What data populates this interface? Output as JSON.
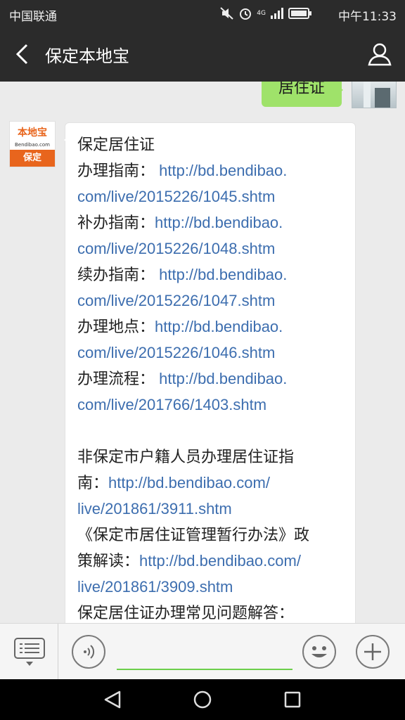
{
  "status_bar": {
    "carrier": "中国联通",
    "time": "中午11:33",
    "network": "4G",
    "icons": [
      "mute-icon",
      "alarm-icon",
      "signal-icon",
      "battery-icon"
    ]
  },
  "header": {
    "title": "保定本地宝",
    "back_icon": "chevron-left-icon",
    "profile_icon": "person-icon"
  },
  "chat": {
    "sent_message": "居住证",
    "bot_avatar": {
      "brand": "本地宝",
      "site": "Bendibao.com",
      "city": "保定"
    },
    "reply_lines": [
      {
        "text": "保定居住证",
        "link": ""
      },
      {
        "text": "办理指南： ",
        "link": "http://bd.bendibao."
      },
      {
        "text": "",
        "link": "com/live/2015226/1045.shtm"
      },
      {
        "text": "补办指南：",
        "link": "http://bd.bendibao."
      },
      {
        "text": "",
        "link": "com/live/2015226/1048.shtm"
      },
      {
        "text": "续办指南： ",
        "link": "http://bd.bendibao."
      },
      {
        "text": "",
        "link": "com/live/2015226/1047.shtm"
      },
      {
        "text": "办理地点：",
        "link": "http://bd.bendibao."
      },
      {
        "text": "",
        "link": "com/live/2015226/1046.shtm"
      },
      {
        "text": "办理流程： ",
        "link": "http://bd.bendibao."
      },
      {
        "text": "",
        "link": "com/live/201766/1403.shtm"
      },
      {
        "text": "",
        "link": ""
      },
      {
        "text": "非保定市户籍人员办理居住证指",
        "link": ""
      },
      {
        "text": "南：",
        "link": "http://bd.bendibao.com/"
      },
      {
        "text": "",
        "link": "live/201861/3911.shtm"
      },
      {
        "text": "《保定市居住证管理暂行办法》政",
        "link": ""
      },
      {
        "text": "策解读：",
        "link": "http://bd.bendibao.com/"
      },
      {
        "text": "",
        "link": "live/201861/3909.shtm"
      },
      {
        "text": "保定居住证办理常见问题解答：",
        "link": ""
      }
    ]
  },
  "input_bar": {
    "menu_icon": "menu-list-icon",
    "voice_icon": "voice-icon",
    "emoji_icon": "emoji-icon",
    "plus_icon": "plus-icon",
    "accent_color": "#6ccf4b"
  },
  "nav_bar": {
    "icons": [
      "back-triangle-icon",
      "home-circle-icon",
      "recent-square-icon"
    ]
  }
}
